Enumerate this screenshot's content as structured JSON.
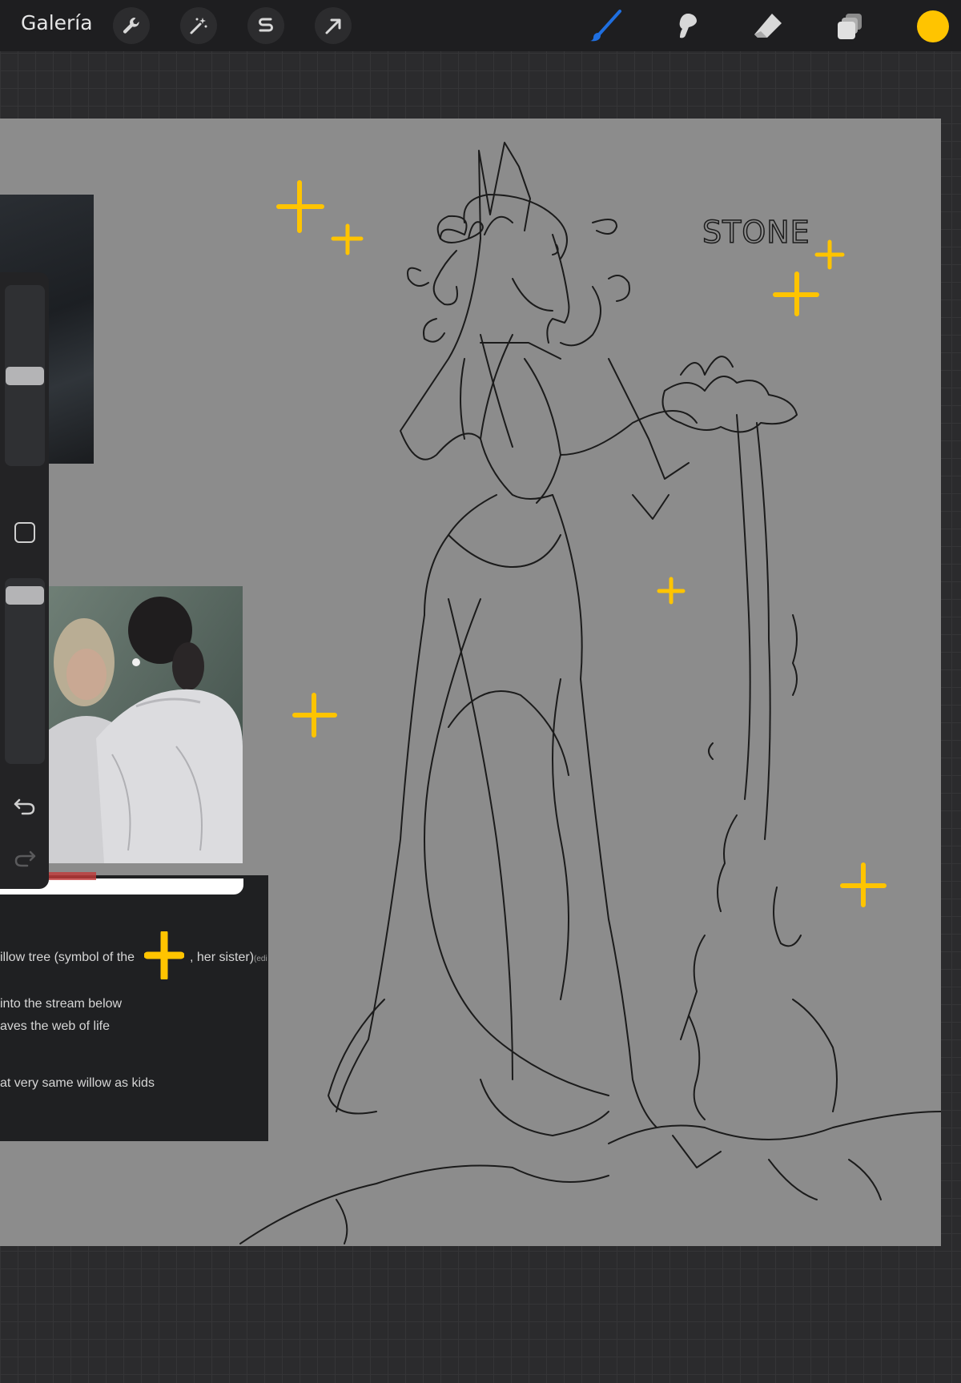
{
  "toolbar": {
    "gallery_label": "Galería",
    "left_tools": [
      "wrench-icon",
      "magic-wand-icon",
      "selection-s-icon",
      "transform-arrow-icon"
    ],
    "right_tools": [
      "brush-icon",
      "smudge-icon",
      "eraser-icon",
      "layers-icon"
    ],
    "current_color": "#ffc400",
    "active_tool_color": "#1f6fe0"
  },
  "sidebar": {
    "brush_size": 0.5,
    "brush_opacity": 0.95,
    "buttons": [
      "modify-square-icon",
      "undo-icon",
      "redo-icon"
    ]
  },
  "canvas": {
    "background": "#8c8c8c",
    "sketch_label": "STONE",
    "sparkle_color": "#ffc400"
  },
  "reference": {
    "text_lines": [
      "illow tree (symbol of the",
      ", her sister)",
      "(edi",
      "into the stream below",
      "aves the web of life",
      "at very same willow as kids"
    ]
  }
}
